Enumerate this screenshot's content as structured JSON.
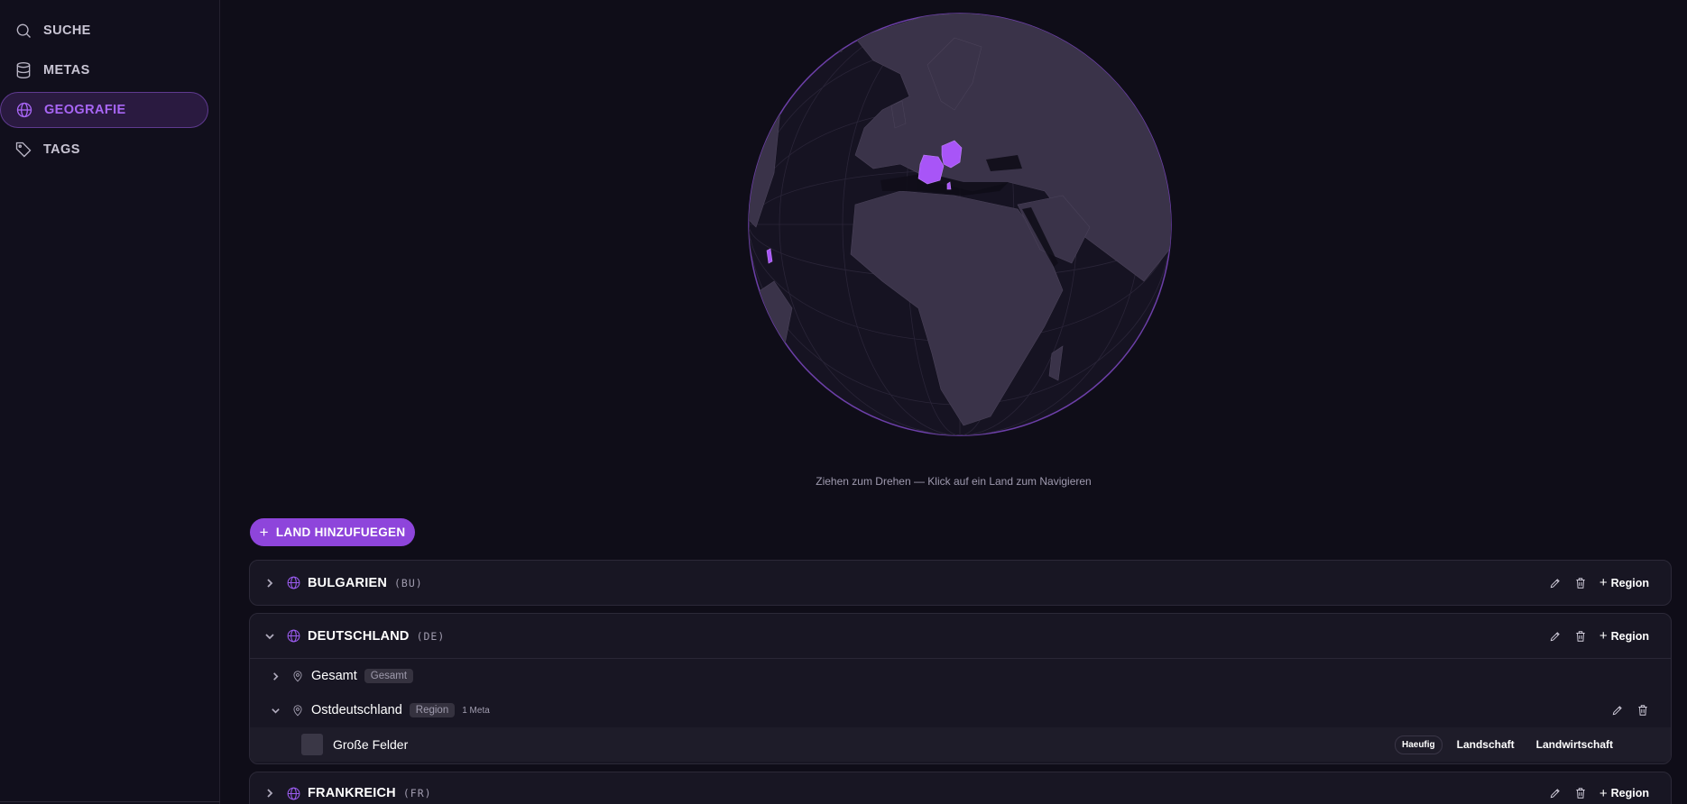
{
  "sidebar": {
    "items": [
      {
        "label": "SUCHE",
        "icon": "search-icon"
      },
      {
        "label": "METAS",
        "icon": "database-icon"
      },
      {
        "label": "GEOGRAFIE",
        "icon": "globe-icon",
        "active": true
      },
      {
        "label": "TAGS",
        "icon": "tag-icon"
      }
    ]
  },
  "globe": {
    "hint": "Ziehen zum Drehen — Klick auf ein Land zum Navigieren",
    "highlighted_color": "#a855f7"
  },
  "add_country": {
    "label": "LAND HINZUFUEGEN"
  },
  "countries": [
    {
      "name": "BULGARIEN",
      "code": "(BU)",
      "region_label": "Region",
      "expanded": false
    },
    {
      "name": "DEUTSCHLAND",
      "code": "(DE)",
      "region_label": "Region",
      "expanded": true,
      "regions": [
        {
          "name": "Gesamt",
          "type": "Gesamt",
          "expanded": false
        },
        {
          "name": "Ostdeutschland",
          "type": "Region",
          "meta_count": "1 Meta",
          "expanded": true,
          "metas": [
            {
              "name": "Große Felder",
              "tags": [
                "Haeufig",
                "Landschaft",
                "Landwirtschaft"
              ]
            }
          ]
        }
      ]
    },
    {
      "name": "FRANKREICH",
      "code": "(FR)",
      "region_label": "Region",
      "expanded": false
    }
  ],
  "colors": {
    "accent": "#8e45db",
    "active_nav": "#a866f5",
    "background": "#0f0d18"
  }
}
